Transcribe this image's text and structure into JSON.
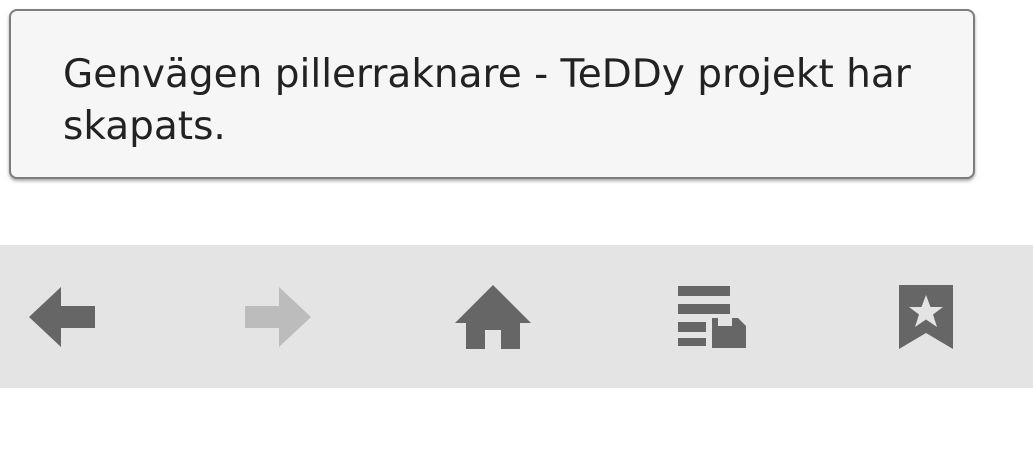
{
  "toast": {
    "message": "Genvägen pillerraknare - TeDDy projekt har skapats."
  },
  "toolbar": {
    "buttons": [
      {
        "name": "back",
        "icon": "arrow-left-icon",
        "enabled": true
      },
      {
        "name": "forward",
        "icon": "arrow-right-icon",
        "enabled": false
      },
      {
        "name": "home",
        "icon": "home-icon",
        "enabled": true
      },
      {
        "name": "saved-pages",
        "icon": "saved-pages-icon",
        "enabled": true
      },
      {
        "name": "bookmarks",
        "icon": "bookmark-star-icon",
        "enabled": true
      }
    ]
  },
  "colors": {
    "toolbar_bg": "#e4e4e4",
    "icon_enabled": "#666666",
    "icon_disabled": "#bcbcbc",
    "toast_bg": "#f6f6f6",
    "toast_border": "#7d7d7d",
    "text": "#222222"
  }
}
